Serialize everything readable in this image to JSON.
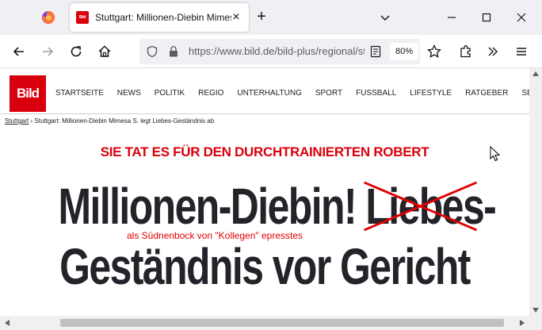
{
  "browser": {
    "tab_title": "Stuttgart: Millionen-Diebin Mimesa S. legt Liebes-Geständnis ab",
    "tab_favicon": "Bild",
    "url": "https://www.bild.de/bild-plus/regional/stuttgart",
    "zoom": "80%"
  },
  "site": {
    "logo": "Bild",
    "nav": [
      "STARTSEITE",
      "NEWS",
      "POLITIK",
      "REGIO",
      "UNTERHALTUNG",
      "SPORT",
      "FUSSBALL",
      "LIFESTYLE",
      "RATGEBER",
      "SEX & LIEBE"
    ]
  },
  "article": {
    "breadcrumb_link": "Stuttgart",
    "breadcrumb_sep": "›",
    "breadcrumb_current": "Stuttgart: Millionen-Diebin Mimesa S. legt Liebes-Geständnis ab",
    "kicker": "SIE TAT ES FÜR DEN DURCHTRAINIERTEN ROBERT",
    "headline_part1": "Millionen-Diebin!",
    "headline_struck": "Liebes",
    "headline_dash": "-",
    "headline_line2": "Geständnis vor Gericht",
    "annotation": "als Südnenbock von \"Kollegen\" epresstes"
  },
  "colors": {
    "brand_red": "#d9000d",
    "annotation_red": "#e00000",
    "headline": "#24232a"
  },
  "icons": {
    "app": "firefox-icon",
    "back": "arrow-left-icon",
    "forward": "arrow-right-icon",
    "reload": "reload-icon",
    "home": "home-icon",
    "tracking": "shield-icon",
    "security": "lock-icon",
    "reader": "reader-view-icon",
    "bookmark": "star-icon",
    "extensions": "puzzle-icon",
    "overflow": "chevron-double-right-icon",
    "menu": "hamburger-menu-icon"
  }
}
